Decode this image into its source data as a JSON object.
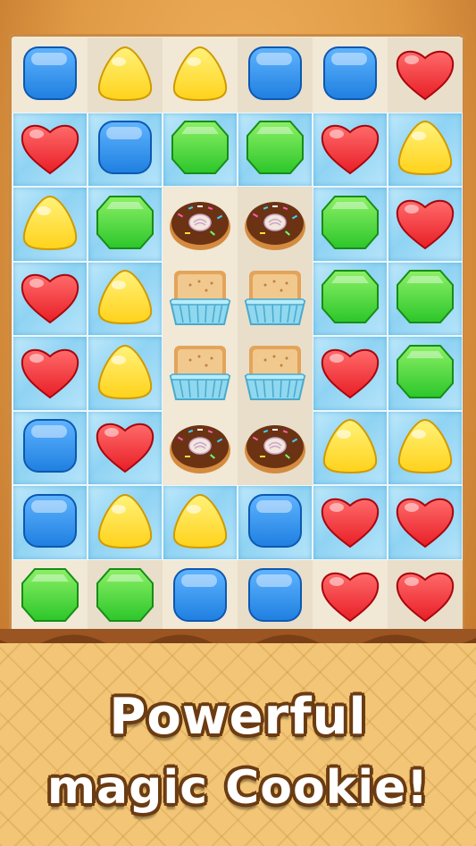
{
  "caption": {
    "line1": "Powerful",
    "line2": "magic Cookie!"
  },
  "board": {
    "rows": 8,
    "cols": 6,
    "cells": [
      [
        {
          "piece": "blue-cube",
          "ice": false
        },
        {
          "piece": "yellow-drop",
          "ice": false
        },
        {
          "piece": "yellow-drop",
          "ice": false
        },
        {
          "piece": "blue-cube",
          "ice": false
        },
        {
          "piece": "blue-cube",
          "ice": false
        },
        {
          "piece": "red-heart",
          "ice": false
        }
      ],
      [
        {
          "piece": "red-heart",
          "ice": true
        },
        {
          "piece": "blue-cube",
          "ice": true
        },
        {
          "piece": "green-gem",
          "ice": true
        },
        {
          "piece": "green-gem",
          "ice": true
        },
        {
          "piece": "red-heart",
          "ice": true
        },
        {
          "piece": "yellow-drop",
          "ice": true
        }
      ],
      [
        {
          "piece": "yellow-drop",
          "ice": true
        },
        {
          "piece": "green-gem",
          "ice": true
        },
        {
          "piece": "donut",
          "ice": false
        },
        {
          "piece": "donut",
          "ice": false
        },
        {
          "piece": "green-gem",
          "ice": true
        },
        {
          "piece": "red-heart",
          "ice": true
        }
      ],
      [
        {
          "piece": "red-heart",
          "ice": true
        },
        {
          "piece": "yellow-drop",
          "ice": true
        },
        {
          "piece": "cake",
          "ice": false
        },
        {
          "piece": "cake",
          "ice": false
        },
        {
          "piece": "green-gem",
          "ice": true
        },
        {
          "piece": "green-gem",
          "ice": true
        }
      ],
      [
        {
          "piece": "red-heart",
          "ice": true
        },
        {
          "piece": "yellow-drop",
          "ice": true
        },
        {
          "piece": "cake",
          "ice": false
        },
        {
          "piece": "cake",
          "ice": false
        },
        {
          "piece": "red-heart",
          "ice": true
        },
        {
          "piece": "green-gem",
          "ice": true
        }
      ],
      [
        {
          "piece": "blue-cube",
          "ice": true
        },
        {
          "piece": "red-heart",
          "ice": true
        },
        {
          "piece": "donut",
          "ice": false
        },
        {
          "piece": "donut",
          "ice": false
        },
        {
          "piece": "yellow-drop",
          "ice": true
        },
        {
          "piece": "yellow-drop",
          "ice": true
        }
      ],
      [
        {
          "piece": "blue-cube",
          "ice": true
        },
        {
          "piece": "yellow-drop",
          "ice": true
        },
        {
          "piece": "yellow-drop",
          "ice": true
        },
        {
          "piece": "blue-cube",
          "ice": true
        },
        {
          "piece": "red-heart",
          "ice": true
        },
        {
          "piece": "red-heart",
          "ice": true
        }
      ],
      [
        {
          "piece": "green-gem",
          "ice": false
        },
        {
          "piece": "green-gem",
          "ice": false
        },
        {
          "piece": "blue-cube",
          "ice": false
        },
        {
          "piece": "blue-cube",
          "ice": false
        },
        {
          "piece": "red-heart",
          "ice": false
        },
        {
          "piece": "red-heart",
          "ice": false
        }
      ]
    ]
  },
  "colors": {
    "blue": "#1f7fe0",
    "yellow": "#ffd21a",
    "green": "#2cc62a",
    "red": "#e81e26",
    "frame": "#d98a3a",
    "chocolate": "#7a3f16",
    "waffle": "#f2c676"
  }
}
